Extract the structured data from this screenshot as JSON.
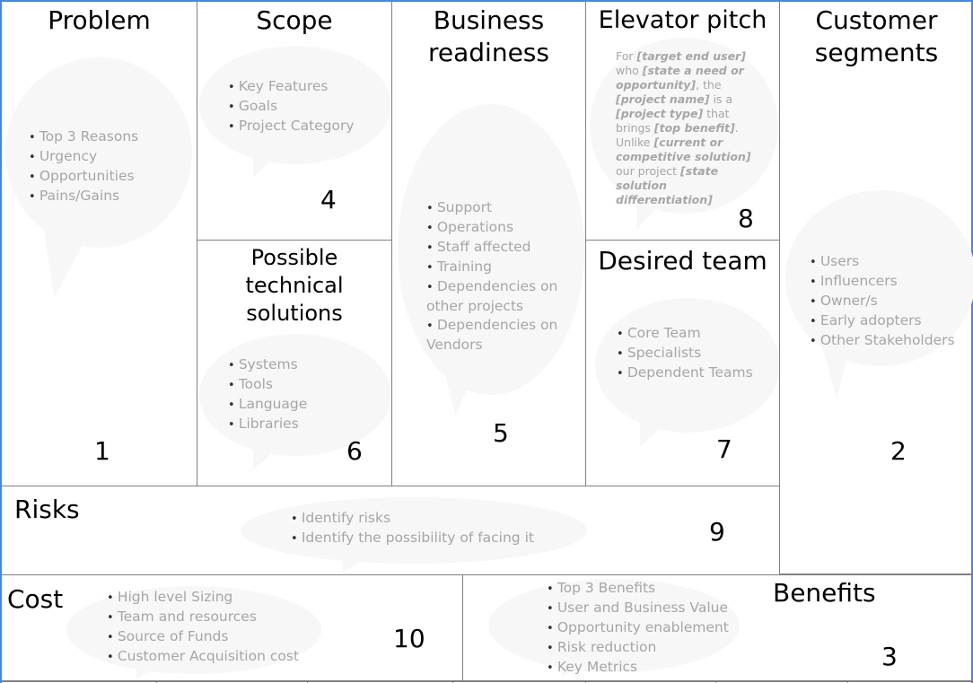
{
  "canvas": {
    "sections": {
      "problem": {
        "title": "Problem",
        "number": "1",
        "items": [
          "Top 3 Reasons",
          "Urgency",
          "Opportunities",
          "Pains/Gains"
        ]
      },
      "scope": {
        "title": "Scope",
        "number": "4",
        "items": [
          "Key Features",
          "Goals",
          "Project Category"
        ]
      },
      "technical": {
        "title_lines": [
          "Possible",
          "technical",
          "solutions"
        ],
        "number": "6",
        "items": [
          "Systems",
          "Tools",
          "Language",
          "Libraries"
        ]
      },
      "business": {
        "title_lines": [
          "Business",
          "readiness"
        ],
        "number": "5",
        "items": [
          "Support",
          "Operations",
          "Staff affected",
          "Training",
          "Dependencies on other projects",
          "Dependencies on Vendors"
        ]
      },
      "pitch": {
        "title": "Elevator pitch",
        "number": "8",
        "segments": [
          {
            "t": "For ",
            "b": false
          },
          {
            "t": "[target end user]",
            "b": true
          },
          {
            "t": " who ",
            "b": false
          },
          {
            "t": "[state a need or opportunity]",
            "b": true
          },
          {
            "t": ", the ",
            "b": false
          },
          {
            "t": "[project name]",
            "b": true
          },
          {
            "t": " is a ",
            "b": false
          },
          {
            "t": "[project type]",
            "b": true
          },
          {
            "t": " that brings ",
            "b": false
          },
          {
            "t": "[top benefit]",
            "b": true
          },
          {
            "t": ". Unlike ",
            "b": false
          },
          {
            "t": "[current or competitive solution]",
            "b": true
          },
          {
            "t": " our project ",
            "b": false
          },
          {
            "t": "[state solution differentiation]",
            "b": true
          }
        ]
      },
      "team": {
        "title": "Desired team",
        "number": "7",
        "items": [
          "Core Team",
          "Specialists",
          "Dependent Teams"
        ]
      },
      "customers": {
        "title_lines": [
          "Customer",
          "segments"
        ],
        "number": "2",
        "items": [
          "Users",
          "Influencers",
          "Owner/s",
          "Early adopters",
          "Other Stakeholders"
        ]
      },
      "risks": {
        "title": "Risks",
        "number": "9",
        "items": [
          "Identify risks",
          "Identify the possibility of facing it"
        ]
      },
      "cost": {
        "title": "Cost",
        "number": "10",
        "items": [
          "High level Sizing",
          "Team and resources",
          "Source of Funds",
          "Customer Acquisition cost"
        ]
      },
      "benefits": {
        "title": "Benefits",
        "number": "3",
        "items": [
          "Top 3 Benefits",
          "User and Business Value",
          "Opportunity enablement",
          "Risk reduction",
          "Key Metrics"
        ]
      }
    },
    "colors": {
      "hint_text": "#a6a6a6",
      "bubble": "#f7f7f7",
      "border": "#808080",
      "frame": "#4a86d9"
    }
  }
}
